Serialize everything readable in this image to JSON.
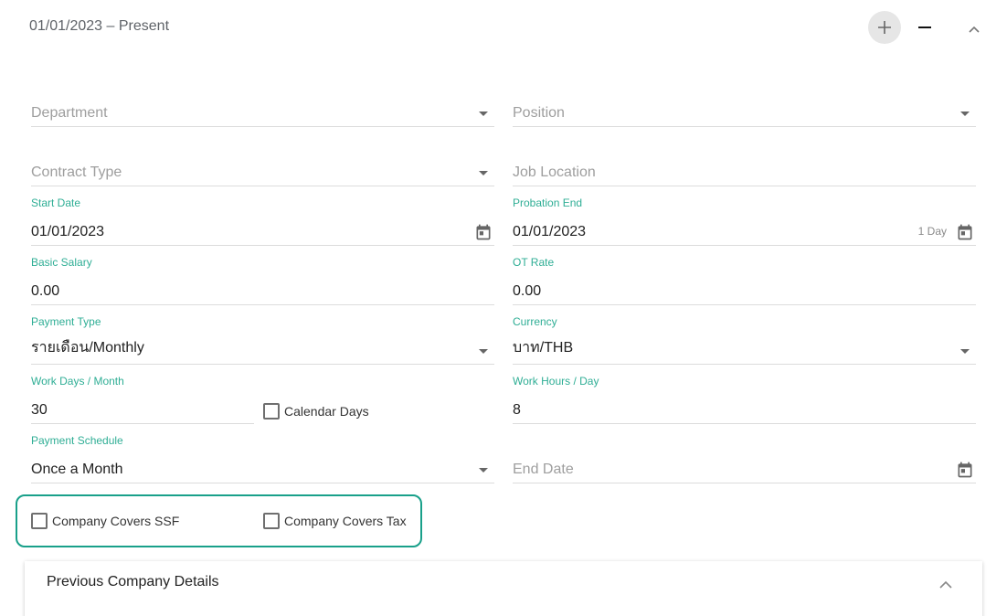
{
  "header": {
    "date_range": "01/01/2023 – Present",
    "add_icon": "plus-icon",
    "remove_icon": "minus-icon",
    "collapse_icon": "chevron-up-icon"
  },
  "form": {
    "department": {
      "placeholder": "Department"
    },
    "position": {
      "placeholder": "Position"
    },
    "contract_type": {
      "placeholder": "Contract Type"
    },
    "job_location": {
      "placeholder": "Job Location"
    },
    "start_date": {
      "label": "Start Date",
      "value": "01/01/2023"
    },
    "probation_end": {
      "label": "Probation End",
      "value": "01/01/2023",
      "suffix": "1 Day"
    },
    "basic_salary": {
      "label": "Basic Salary",
      "value": "0.00"
    },
    "ot_rate": {
      "label": "OT Rate",
      "value": "0.00"
    },
    "payment_type": {
      "label": "Payment Type",
      "value": "รายเดือน/Monthly"
    },
    "currency": {
      "label": "Currency",
      "value": "บาท/THB"
    },
    "work_days": {
      "label": "Work Days / Month",
      "value": "30"
    },
    "calendar_days": {
      "label": "Calendar Days",
      "checked": false
    },
    "work_hours": {
      "label": "Work Hours / Day",
      "value": "8"
    },
    "payment_schedule": {
      "label": "Payment Schedule",
      "value": "Once a Month"
    },
    "end_date": {
      "placeholder": "End Date"
    },
    "company_covers_ssf": {
      "label": "Company Covers SSF",
      "checked": false
    },
    "company_covers_tax": {
      "label": "Company Covers Tax",
      "checked": false
    }
  },
  "previous_company": {
    "title": "Previous Company Details"
  },
  "colors": {
    "accent": "#2fae95",
    "highlight_border": "#19a08a",
    "placeholder": "#9e9e9e",
    "underline": "#dcdcdc"
  }
}
